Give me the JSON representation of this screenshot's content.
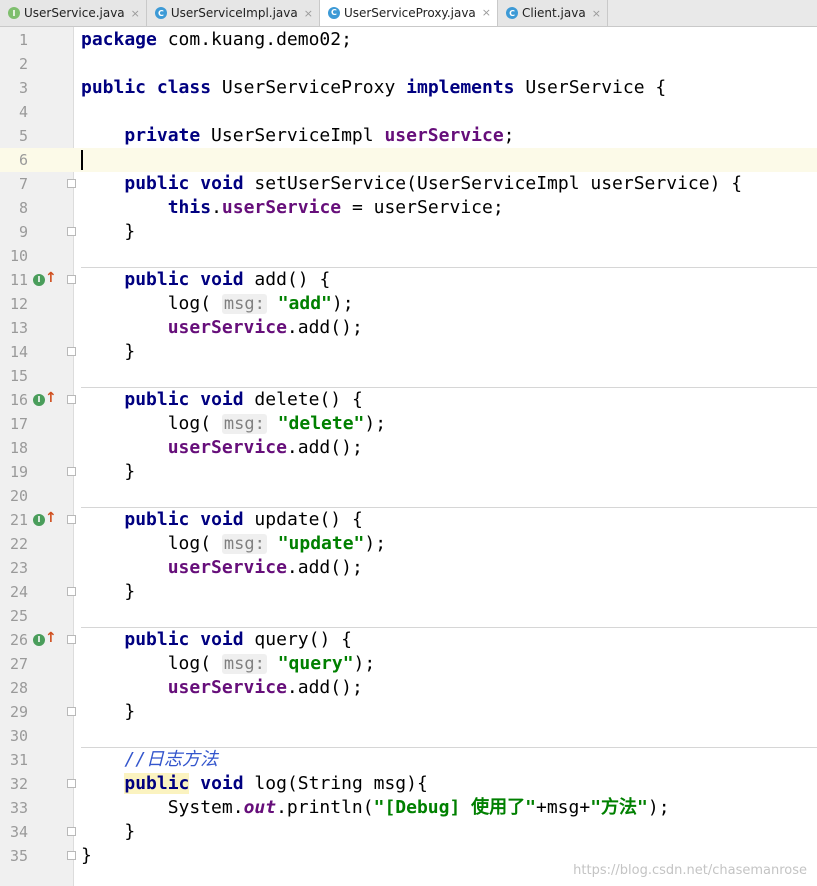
{
  "tabs": [
    {
      "label": "UserService.java",
      "icon": "interface-file-icon",
      "active": false
    },
    {
      "label": "UserServiceImpl.java",
      "icon": "class-file-icon",
      "active": false
    },
    {
      "label": "UserServiceProxy.java",
      "icon": "class-file-icon",
      "active": true
    },
    {
      "label": "Client.java",
      "icon": "class-file-icon",
      "active": false
    }
  ],
  "close_glyph": "×",
  "editor": {
    "line_numbers": [
      "1",
      "2",
      "3",
      "4",
      "5",
      "6",
      "7",
      "8",
      "9",
      "10",
      "11",
      "12",
      "13",
      "14",
      "15",
      "16",
      "17",
      "18",
      "19",
      "20",
      "21",
      "22",
      "23",
      "24",
      "25",
      "26",
      "27",
      "28",
      "29",
      "30",
      "31",
      "32",
      "33",
      "34",
      "35"
    ],
    "current_line": "6",
    "param_hint": "msg:",
    "code": {
      "l1": [
        "package",
        " com.kuang.demo02;"
      ],
      "l3": [
        "public",
        " ",
        "class",
        " UserServiceProxy ",
        "implements",
        " UserService {"
      ],
      "l5": [
        "private",
        " UserServiceImpl ",
        "userService",
        ";"
      ],
      "l7": [
        "public",
        " ",
        "void",
        " setUserService(UserServiceImpl userService) {"
      ],
      "l8": [
        "this",
        ".",
        "userService",
        " = userService;"
      ],
      "brace": "}",
      "l11": [
        "public",
        " ",
        "void",
        " add() {"
      ],
      "l12": [
        "log( ",
        "\"add\"",
        ");"
      ],
      "call": [
        "userService",
        ".add();"
      ],
      "l16": [
        "public",
        " ",
        "void",
        " delete() {"
      ],
      "l17": [
        "log( ",
        "\"delete\"",
        ");"
      ],
      "l21": [
        "public",
        " ",
        "void",
        " update() {"
      ],
      "l22": [
        "log( ",
        "\"update\"",
        ");"
      ],
      "l26": [
        "public",
        " ",
        "void",
        " query() {"
      ],
      "l27": [
        "log( ",
        "\"query\"",
        ");"
      ],
      "l31": "//日志方法",
      "l32": [
        "public",
        " ",
        "void",
        " log(String msg){"
      ],
      "l33": [
        "System.",
        "out",
        ".println(",
        "\"[Debug] 使用了\"",
        "+msg+",
        "\"方法\"",
        ");"
      ]
    }
  },
  "watermark": "https://blog.csdn.net/chasemanrose",
  "colors": {
    "keyword": "#000080",
    "field": "#660e7a",
    "string": "#008000",
    "comment": "#3355cc"
  }
}
